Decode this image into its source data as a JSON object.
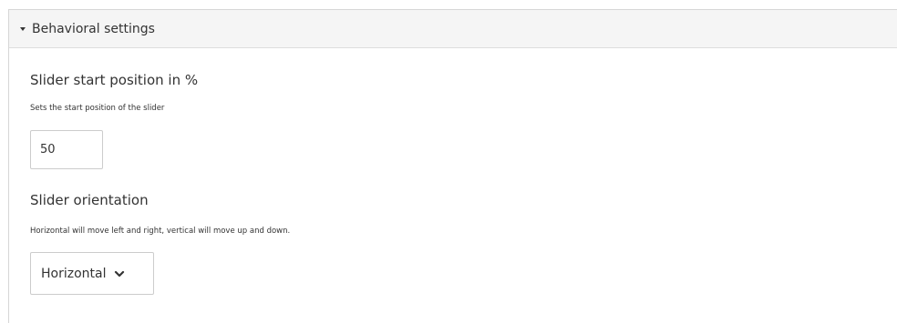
{
  "panel": {
    "title": "Behavioral settings",
    "expanded": true
  },
  "fields": {
    "start_position": {
      "label": "Slider start position in %",
      "description": "Sets the start position of the slider",
      "value": "50"
    },
    "orientation": {
      "label": "Slider orientation",
      "description": "Horizontal will move left and right, vertical will move up and down.",
      "selected": "Horizontal"
    }
  },
  "icons": {
    "collapse": "caret-down-icon",
    "select": "chevron-down-icon"
  }
}
